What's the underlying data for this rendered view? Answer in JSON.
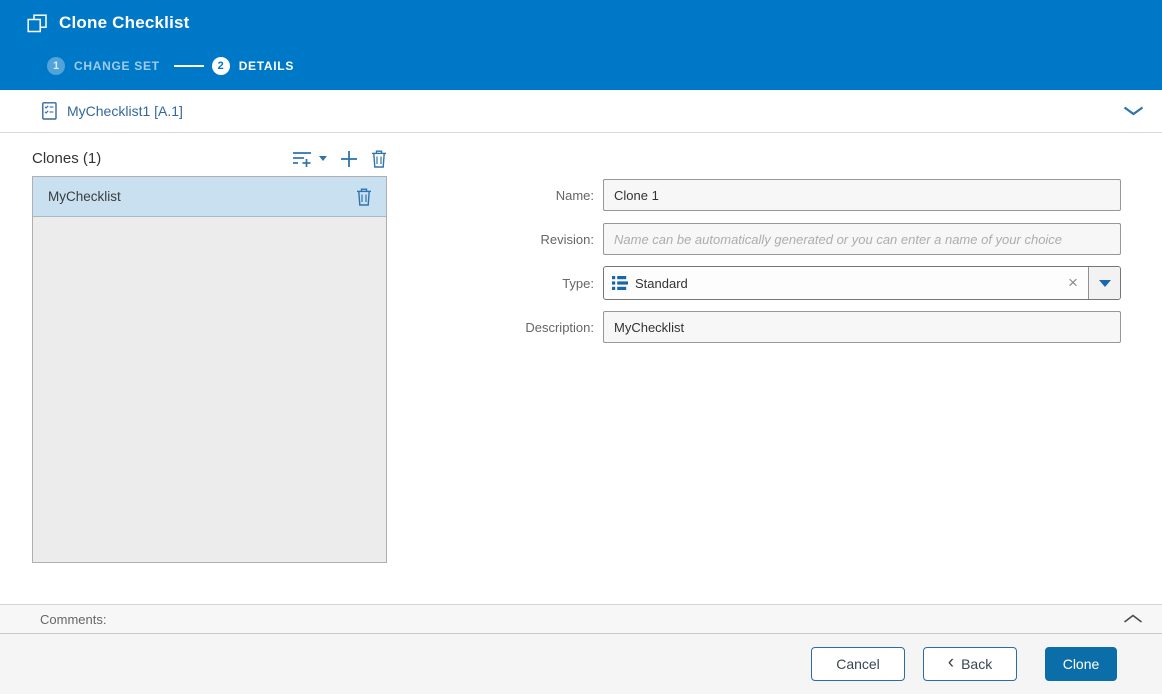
{
  "dialog": {
    "title": "Clone Checklist"
  },
  "steps": {
    "step1": {
      "number": "1",
      "label": "CHANGE SET"
    },
    "step2": {
      "number": "2",
      "label": "DETAILS"
    }
  },
  "context_bar": {
    "item": "MyChecklist1 [A.1]"
  },
  "clones_panel": {
    "header": "Clones (1)",
    "items": [
      {
        "label": "MyChecklist"
      }
    ]
  },
  "form": {
    "name_label": "Name:",
    "name_value": "Clone 1",
    "revision_label": "Revision:",
    "revision_placeholder": "Name can be automatically generated or you can enter a name of your choice",
    "type_label": "Type:",
    "type_value": "Standard",
    "description_label": "Description:",
    "description_value": "MyChecklist"
  },
  "comments": {
    "label": "Comments:"
  },
  "footer": {
    "cancel": "Cancel",
    "back": "Back",
    "back_chevron": "‹",
    "clone": "Clone"
  },
  "icons": {
    "clear": "×"
  },
  "colors": {
    "header_blue": "#0078C8",
    "primary_button": "#0C6EA8",
    "link_blue": "#33689E",
    "icon_blue": "#2E74AD",
    "selection_bg": "#C9E0F1"
  }
}
